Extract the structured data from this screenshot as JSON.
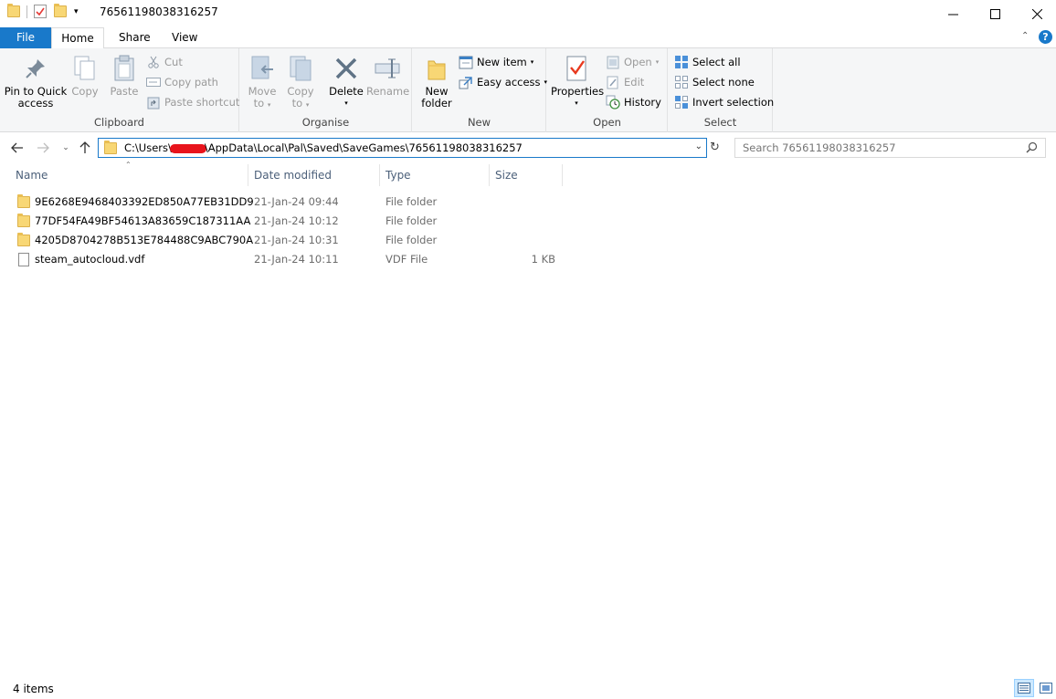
{
  "window": {
    "title": "76561198038316257"
  },
  "ribbon_tabs": {
    "file": "File",
    "home": "Home",
    "share": "Share",
    "view": "View",
    "help": "?"
  },
  "clipboard": {
    "label": "Clipboard",
    "pin_line1": "Pin to Quick",
    "pin_line2": "access",
    "copy": "Copy",
    "paste": "Paste",
    "cut": "Cut",
    "copy_path": "Copy path",
    "paste_shortcut": "Paste shortcut"
  },
  "organise": {
    "label": "Organise",
    "move_line1": "Move",
    "move_line2": "to",
    "copy_line1": "Copy",
    "copy_line2": "to",
    "delete": "Delete",
    "rename": "Rename"
  },
  "new": {
    "label": "New",
    "folder_line1": "New",
    "folder_line2": "folder",
    "new_item": "New item",
    "easy_access": "Easy access"
  },
  "open": {
    "label": "Open",
    "properties": "Properties",
    "open": "Open",
    "edit": "Edit",
    "history": "History"
  },
  "select": {
    "label": "Select",
    "select_all": "Select all",
    "select_none": "Select none",
    "invert_selection": "Invert selection"
  },
  "address": {
    "path_start": "C:\\Users\\",
    "path_end": "\\AppData\\Local\\Pal\\Saved\\SaveGames\\76561198038316257",
    "search_placeholder": "Search 76561198038316257"
  },
  "columns": {
    "name": "Name",
    "date_modified": "Date modified",
    "type": "Type",
    "size": "Size"
  },
  "files": [
    {
      "name": "9E6268E9468403392ED850A77EB31DD9",
      "date": "21-Jan-24 09:44",
      "type": "File folder",
      "size": ""
    },
    {
      "name": "77DF54FA49BF54613A83659C187311AA",
      "date": "21-Jan-24 10:12",
      "type": "File folder",
      "size": ""
    },
    {
      "name": "4205D8704278B513E784488C9ABC790A",
      "date": "21-Jan-24 10:31",
      "type": "File folder",
      "size": ""
    },
    {
      "name": "steam_autocloud.vdf",
      "date": "21-Jan-24 10:11",
      "type": "VDF File",
      "size": "1 KB"
    }
  ],
  "status": {
    "item_count": "4 items"
  },
  "colors": {
    "accent": "#1979ca",
    "folder": "#f8d775",
    "redaction": "#e8141c"
  }
}
